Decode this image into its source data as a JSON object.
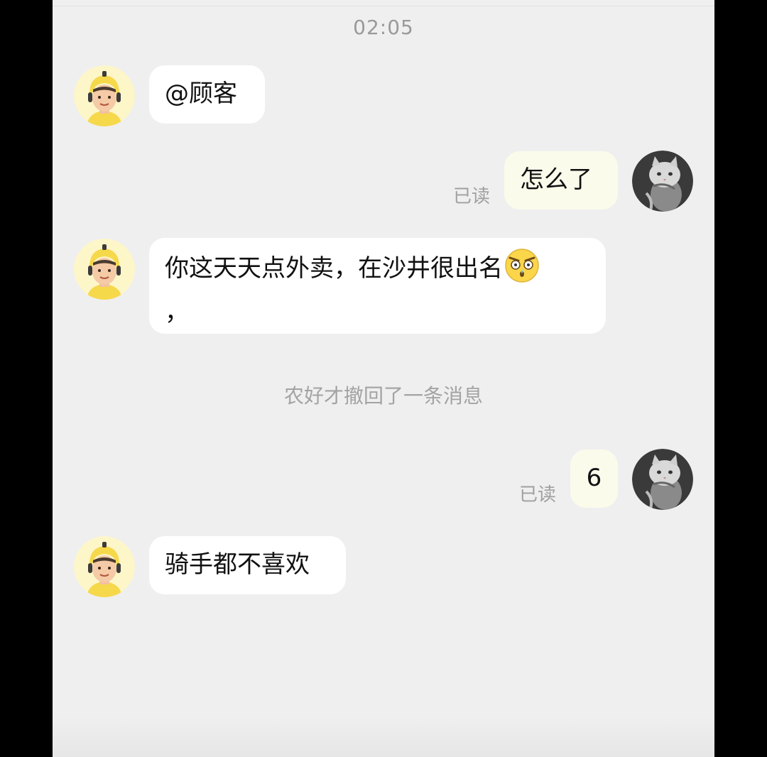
{
  "chat": {
    "timestamp": "02:05",
    "recall_notice": "农好才撤回了一条消息",
    "messages": [
      {
        "side": "in",
        "avatar": "rider-avatar",
        "text": "@顾客"
      },
      {
        "side": "out",
        "avatar": "cat-avatar",
        "text": "怎么了",
        "status": "已读"
      },
      {
        "side": "in",
        "avatar": "rider-avatar",
        "text": "你这天天点外卖，在沙井很出名",
        "text2": "，",
        "emoji": "shocked-face-emoji"
      },
      {
        "side": "out",
        "avatar": "cat-avatar",
        "text": "6",
        "status": "已读"
      },
      {
        "side": "in",
        "avatar": "rider-avatar",
        "text": "骑手都不喜欢"
      }
    ]
  },
  "colors": {
    "background": "#efefef",
    "incoming_bubble": "#ffffff",
    "outgoing_bubble": "#fbfbec",
    "meta_text": "#a0a0a0",
    "rider_helmet": "#f7d84a"
  }
}
